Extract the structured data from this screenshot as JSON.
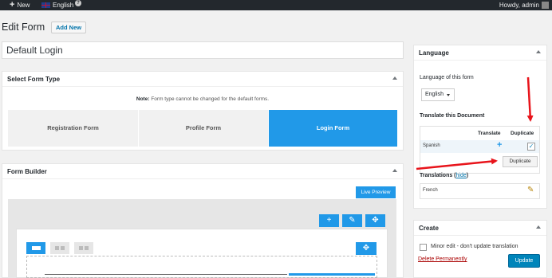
{
  "adminbar": {
    "new_label": "New",
    "language_label": "English",
    "help_icon": "?",
    "greeting": "Howdy, admin"
  },
  "page": {
    "title": "Edit Form",
    "add_new_label": "Add New"
  },
  "form_title_value": "Default Login",
  "form_type": {
    "heading": "Select Form Type",
    "note_bold": "Note:",
    "note_text": "Form type cannot be changed for the default forms.",
    "options": [
      "Registration Form",
      "Profile Form",
      "Login Form"
    ],
    "selected": "Login Form"
  },
  "form_builder": {
    "heading": "Form Builder",
    "live_preview_label": "Live Preview",
    "tool_icons": [
      "+",
      "✎",
      "✥"
    ],
    "row_move_icon": "✥"
  },
  "language_box": {
    "heading": "Language",
    "language_of_post_label": "Language of this form",
    "selected_language": "English",
    "translate_heading": "Translate this Document",
    "col_translate": "Translate",
    "col_duplicate": "Duplicate",
    "spanish": "Spanish",
    "duplicate_tooltip": "Duplicate",
    "translations_label": "Translations",
    "hide_link": "hide",
    "french": "French"
  },
  "create_box": {
    "heading": "Create",
    "minor_edit_label": "Minor edit - don't update translation",
    "delete_label": "Delete Permanently",
    "update_label": "Update"
  },
  "colors": {
    "accent": "#2199e8",
    "admin_bar": "#23282d",
    "arrow": "#e8141b",
    "update": "#0085ba"
  }
}
